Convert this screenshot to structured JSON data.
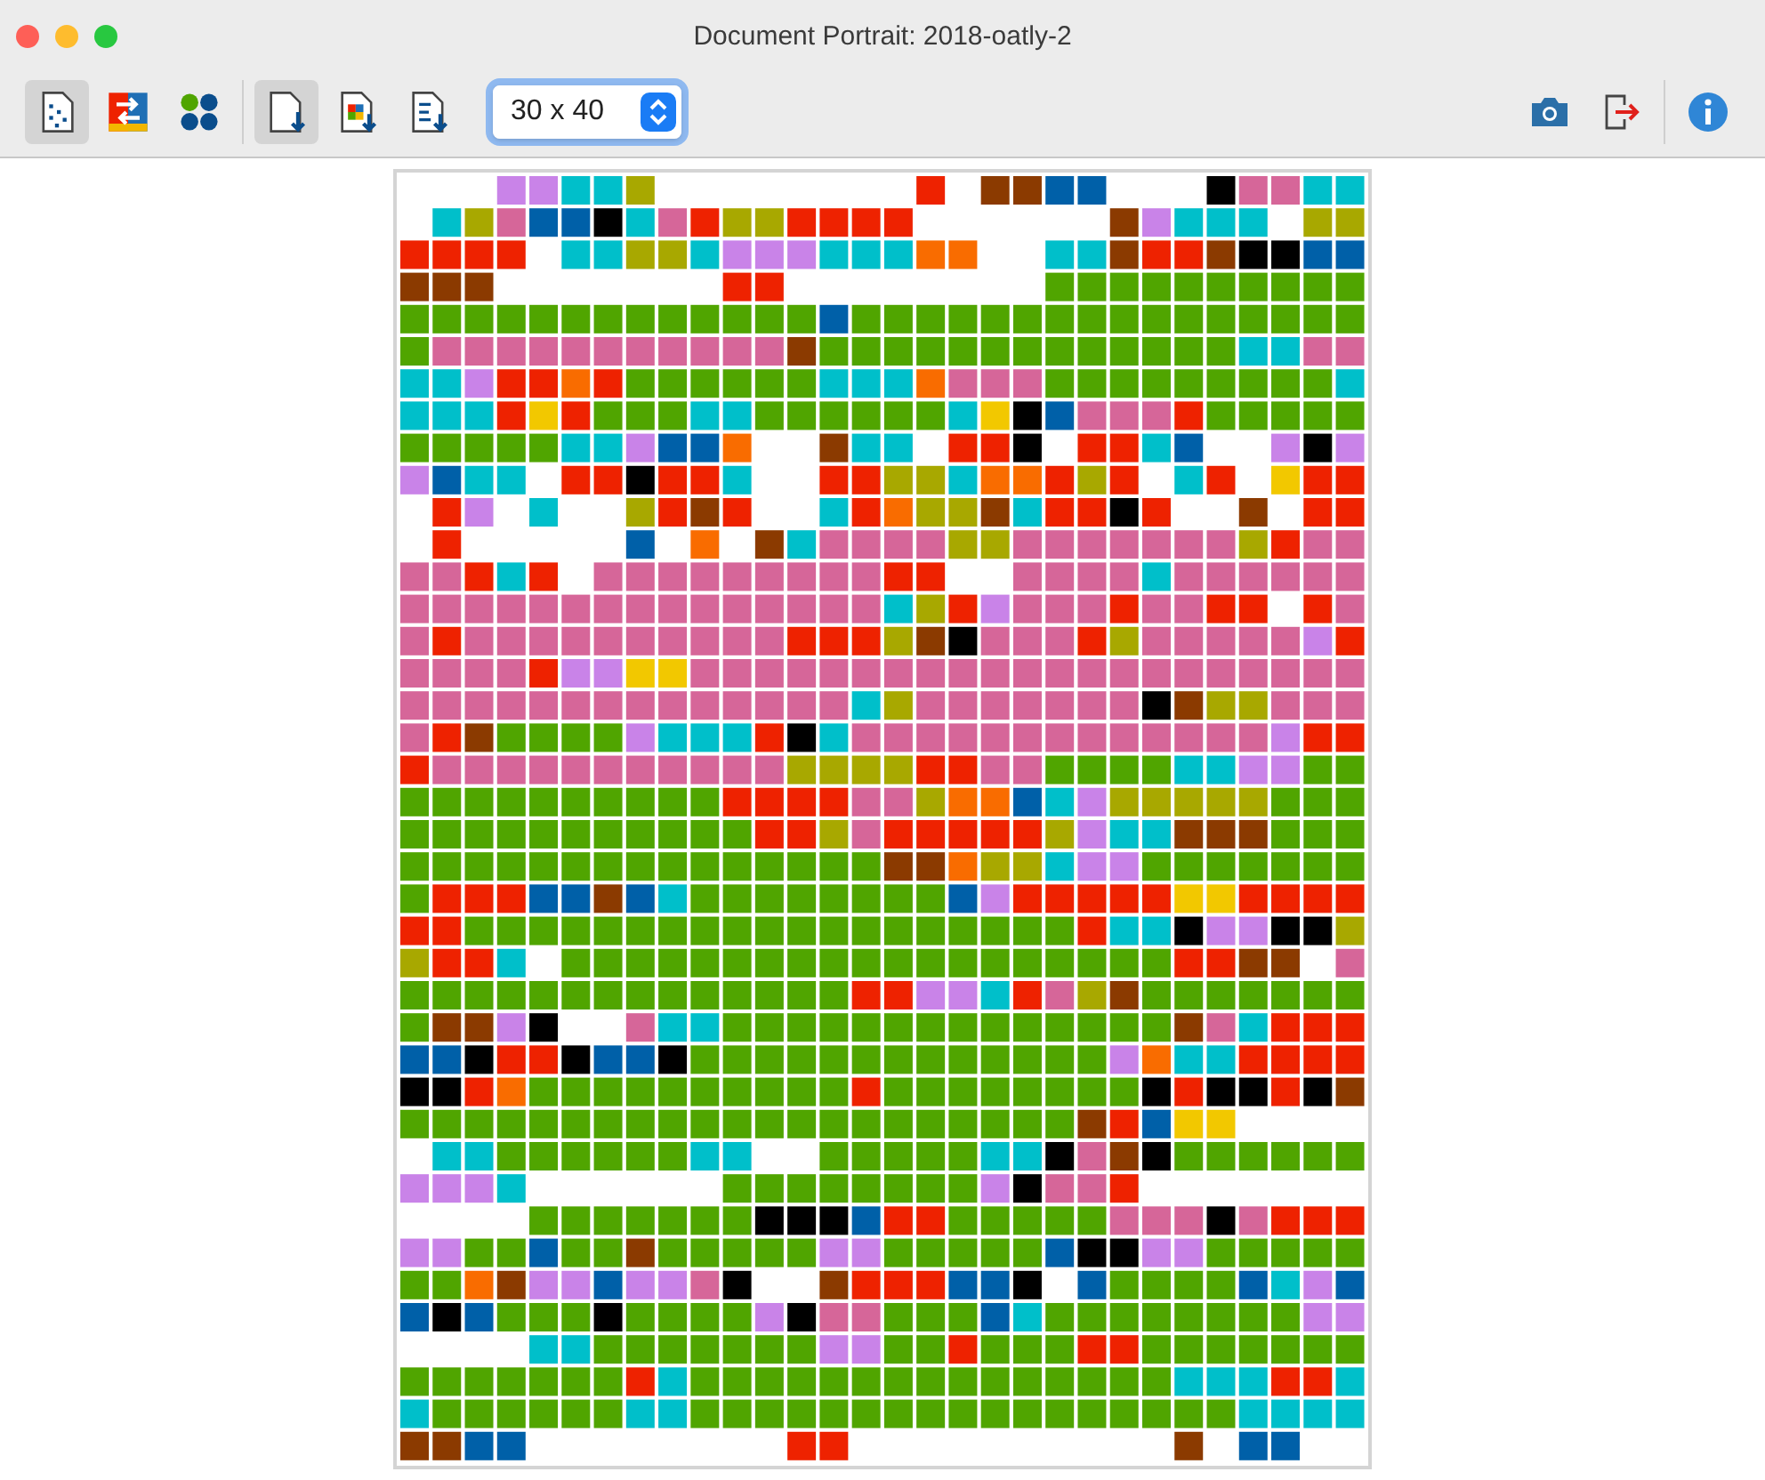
{
  "window": {
    "title": "Document Portrait: 2018-oatly-2"
  },
  "toolbar": {
    "left_groups": [
      [
        {
          "kind": "document-grid",
          "selected": true
        },
        {
          "kind": "swap",
          "selected": false
        },
        {
          "kind": "dots",
          "selected": false
        }
      ],
      [
        {
          "kind": "document-down",
          "selected": true
        },
        {
          "kind": "document-colors",
          "selected": false
        },
        {
          "kind": "document-numbers",
          "selected": false
        }
      ]
    ],
    "size_select": {
      "value": "30 x 40"
    },
    "right_groups": [
      [
        {
          "kind": "camera"
        },
        {
          "kind": "exit"
        }
      ],
      [
        {
          "kind": "info"
        }
      ]
    ]
  }
}
